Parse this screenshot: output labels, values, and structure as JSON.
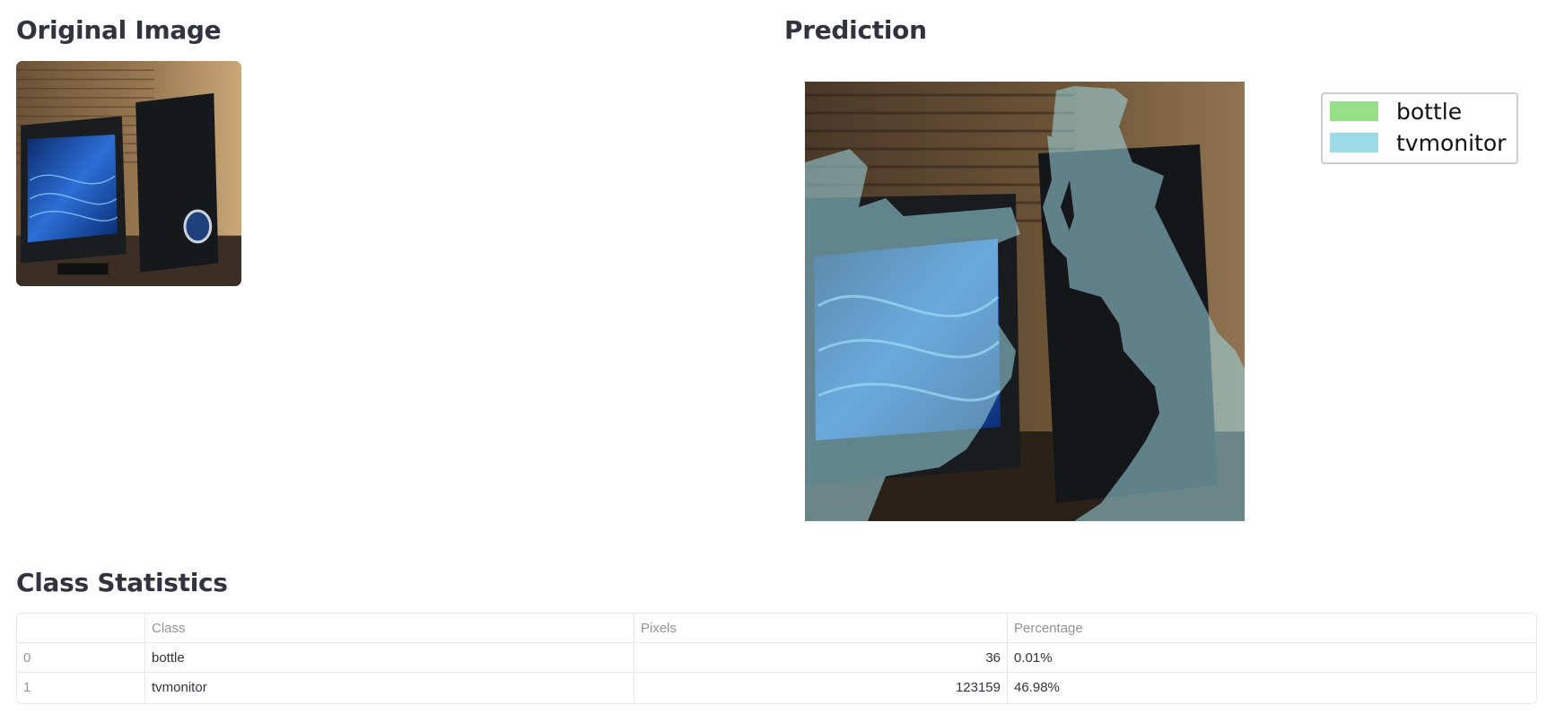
{
  "headings": {
    "original": "Original Image",
    "prediction": "Prediction",
    "stats": "Class Statistics"
  },
  "legend": [
    {
      "label": "bottle",
      "color": "#98df8a"
    },
    {
      "label": "tvmonitor",
      "color": "#9edae5"
    }
  ],
  "table": {
    "columns": [
      "",
      "Class",
      "Pixels",
      "Percentage"
    ],
    "rows": [
      {
        "index": "0",
        "class": "bottle",
        "pixels": "36",
        "percentage": "0.01%"
      },
      {
        "index": "1",
        "class": "tvmonitor",
        "pixels": "123159",
        "percentage": "46.98%"
      }
    ]
  },
  "colors": {
    "overlay_tvmonitor": "#9edae5",
    "overlay_bottle": "#98df8a",
    "screen_blue": "#1a4fa8"
  }
}
